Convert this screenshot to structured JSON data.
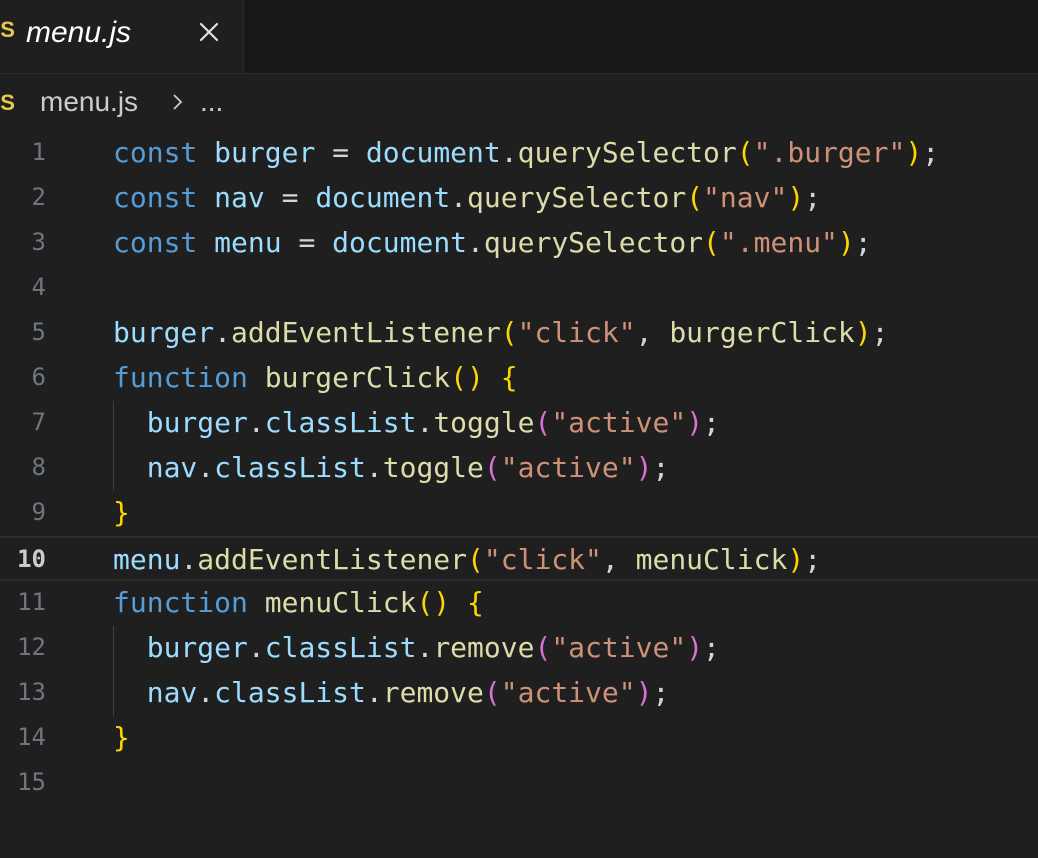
{
  "tab": {
    "icon_text": "JS",
    "title": "menu.js",
    "close_icon": "close-icon"
  },
  "breadcrumb": {
    "icon_text": "JS",
    "file": "menu.js",
    "separator_icon": "chevron-right-icon",
    "more": "..."
  },
  "editor": {
    "current_line": 10,
    "colors": {
      "background": "#1f1f1f",
      "keyword": "#569cd6",
      "variable": "#9cdcfe",
      "function": "#dcdcaa",
      "string": "#ce9178",
      "bracket_level1": "#ffd700",
      "bracket_level2": "#da70d6"
    },
    "lines": [
      {
        "n": "1",
        "tokens": [
          [
            "kw",
            "const"
          ],
          [
            "op",
            " "
          ],
          [
            "var",
            "burger"
          ],
          [
            "op",
            " = "
          ],
          [
            "doc",
            "document"
          ],
          [
            "op",
            "."
          ],
          [
            "fn",
            "querySelector"
          ],
          [
            "br1",
            "("
          ],
          [
            "str",
            "\".burger\""
          ],
          [
            "br1",
            ")"
          ],
          [
            "op",
            ";"
          ]
        ]
      },
      {
        "n": "2",
        "tokens": [
          [
            "kw",
            "const"
          ],
          [
            "op",
            " "
          ],
          [
            "var",
            "nav"
          ],
          [
            "op",
            " = "
          ],
          [
            "doc",
            "document"
          ],
          [
            "op",
            "."
          ],
          [
            "fn",
            "querySelector"
          ],
          [
            "br1",
            "("
          ],
          [
            "str",
            "\"nav\""
          ],
          [
            "br1",
            ")"
          ],
          [
            "op",
            ";"
          ]
        ]
      },
      {
        "n": "3",
        "tokens": [
          [
            "kw",
            "const"
          ],
          [
            "op",
            " "
          ],
          [
            "var",
            "menu"
          ],
          [
            "op",
            " = "
          ],
          [
            "doc",
            "document"
          ],
          [
            "op",
            "."
          ],
          [
            "fn",
            "querySelector"
          ],
          [
            "br1",
            "("
          ],
          [
            "str",
            "\".menu\""
          ],
          [
            "br1",
            ")"
          ],
          [
            "op",
            ";"
          ]
        ]
      },
      {
        "n": "4",
        "tokens": []
      },
      {
        "n": "5",
        "tokens": [
          [
            "var",
            "burger"
          ],
          [
            "op",
            "."
          ],
          [
            "fn",
            "addEventListener"
          ],
          [
            "br1",
            "("
          ],
          [
            "str",
            "\"click\""
          ],
          [
            "op",
            ", "
          ],
          [
            "fn",
            "burgerClick"
          ],
          [
            "br1",
            ")"
          ],
          [
            "op",
            ";"
          ]
        ]
      },
      {
        "n": "6",
        "tokens": [
          [
            "kw",
            "function"
          ],
          [
            "op",
            " "
          ],
          [
            "fn",
            "burgerClick"
          ],
          [
            "br1",
            "()"
          ],
          [
            "op",
            " "
          ],
          [
            "br1",
            "{"
          ]
        ]
      },
      {
        "n": "7",
        "tokens": [
          [
            "op",
            "  "
          ],
          [
            "var",
            "burger"
          ],
          [
            "op",
            "."
          ],
          [
            "var",
            "classList"
          ],
          [
            "op",
            "."
          ],
          [
            "fn",
            "toggle"
          ],
          [
            "br2",
            "("
          ],
          [
            "str",
            "\"active\""
          ],
          [
            "br2",
            ")"
          ],
          [
            "op",
            ";"
          ]
        ]
      },
      {
        "n": "8",
        "tokens": [
          [
            "op",
            "  "
          ],
          [
            "var",
            "nav"
          ],
          [
            "op",
            "."
          ],
          [
            "var",
            "classList"
          ],
          [
            "op",
            "."
          ],
          [
            "fn",
            "toggle"
          ],
          [
            "br2",
            "("
          ],
          [
            "str",
            "\"active\""
          ],
          [
            "br2",
            ")"
          ],
          [
            "op",
            ";"
          ]
        ]
      },
      {
        "n": "9",
        "tokens": [
          [
            "br1",
            "}"
          ]
        ]
      },
      {
        "n": "10",
        "tokens": [
          [
            "var",
            "menu"
          ],
          [
            "op",
            "."
          ],
          [
            "fn",
            "addEventListener"
          ],
          [
            "br1",
            "("
          ],
          [
            "str",
            "\"click\""
          ],
          [
            "op",
            ", "
          ],
          [
            "fn",
            "menuClick"
          ],
          [
            "br1",
            ")"
          ],
          [
            "op",
            ";"
          ]
        ]
      },
      {
        "n": "11",
        "tokens": [
          [
            "kw",
            "function"
          ],
          [
            "op",
            " "
          ],
          [
            "fn",
            "menuClick"
          ],
          [
            "br1",
            "()"
          ],
          [
            "op",
            " "
          ],
          [
            "br1",
            "{"
          ]
        ]
      },
      {
        "n": "12",
        "tokens": [
          [
            "op",
            "  "
          ],
          [
            "var",
            "burger"
          ],
          [
            "op",
            "."
          ],
          [
            "var",
            "classList"
          ],
          [
            "op",
            "."
          ],
          [
            "fn",
            "remove"
          ],
          [
            "br2",
            "("
          ],
          [
            "str",
            "\"active\""
          ],
          [
            "br2",
            ")"
          ],
          [
            "op",
            ";"
          ]
        ]
      },
      {
        "n": "13",
        "tokens": [
          [
            "op",
            "  "
          ],
          [
            "var",
            "nav"
          ],
          [
            "op",
            "."
          ],
          [
            "var",
            "classList"
          ],
          [
            "op",
            "."
          ],
          [
            "fn",
            "remove"
          ],
          [
            "br2",
            "("
          ],
          [
            "str",
            "\"active\""
          ],
          [
            "br2",
            ")"
          ],
          [
            "op",
            ";"
          ]
        ]
      },
      {
        "n": "14",
        "tokens": [
          [
            "br1",
            "}"
          ]
        ]
      },
      {
        "n": "15",
        "tokens": []
      }
    ]
  }
}
